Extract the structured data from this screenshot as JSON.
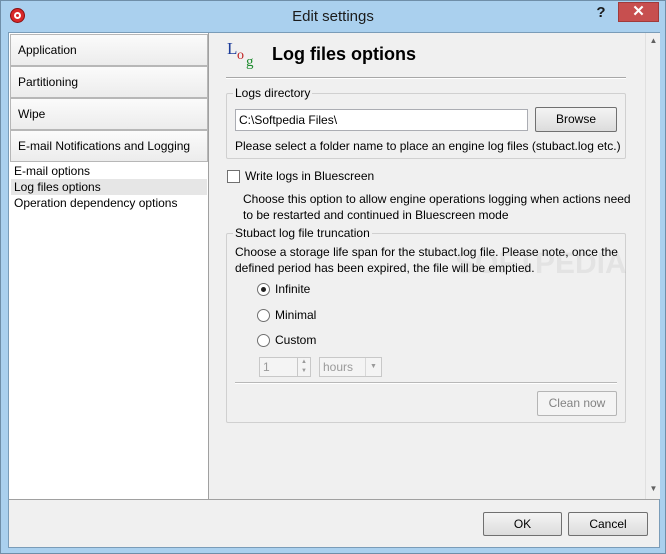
{
  "window": {
    "title": "Edit settings",
    "help_label": "?",
    "close_label": "✕"
  },
  "sidebar": {
    "categories": [
      {
        "label": "Application"
      },
      {
        "label": "Partitioning"
      },
      {
        "label": "Wipe"
      },
      {
        "label": "E-mail Notifications and Logging"
      }
    ],
    "subitems": [
      {
        "label": "E-mail options",
        "selected": false
      },
      {
        "label": "Log files options",
        "selected": true
      },
      {
        "label": "Operation dependency options",
        "selected": false
      }
    ]
  },
  "header": {
    "icon": "log-icon",
    "title": "Log files options"
  },
  "logs_directory": {
    "legend": "Logs directory",
    "value": "C:\\Softpedia Files\\",
    "browse_label": "Browse",
    "hint": "Please select a folder name to place an engine log files (stubact.log etc.)"
  },
  "bluescreen": {
    "label": "Write logs in Bluescreen",
    "checked": false,
    "description": "Choose this option to allow engine operations logging when actions need to be restarted and continued in Bluescreen mode"
  },
  "truncation": {
    "legend": "Stubact log file truncation",
    "description": "Choose a storage life span for the stubact.log file. Please note, once the defined period has been expired, the file will be emptied.",
    "options": [
      {
        "label": "Infinite",
        "checked": true
      },
      {
        "label": "Minimal",
        "checked": false
      },
      {
        "label": "Custom",
        "checked": false
      }
    ],
    "spin_value": "1",
    "unit_value": "hours",
    "clean_label": "Clean now"
  },
  "watermark": "SOFTPEDIA",
  "footer": {
    "ok_label": "OK",
    "cancel_label": "Cancel"
  },
  "colors": {
    "frame": "#aad0ee",
    "close_button": "#c74f4f",
    "client": "#f0f0f0"
  }
}
